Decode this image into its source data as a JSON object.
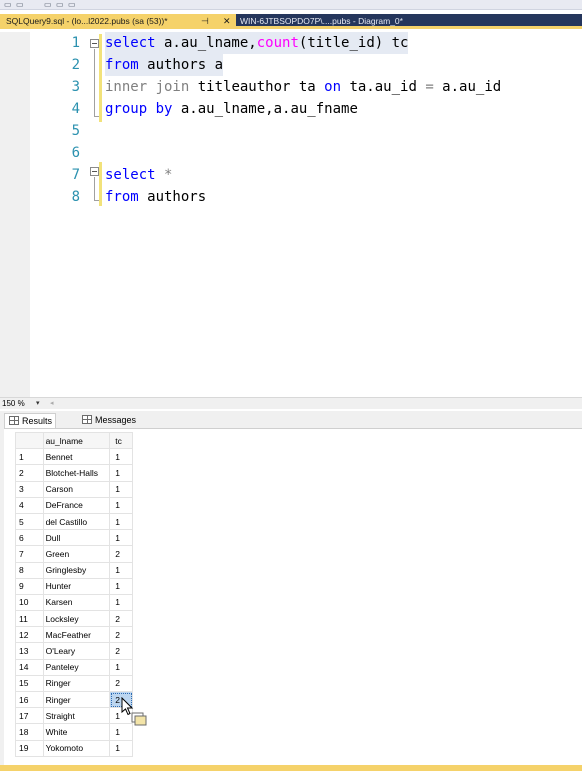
{
  "tabs": {
    "active": "SQLQuery9.sql - (lo...l2022.pubs (sa (53))*",
    "pin_glyph": "⊣",
    "close_glyph": "✕",
    "inactive": "WIN-6JTBSOPDO7P\\....pubs - Diagram_0*"
  },
  "editor": {
    "lines": [
      {
        "n": "1",
        "tokens": [
          {
            "t": "select",
            "c": "kw"
          },
          {
            "t": " a.au_lname,",
            "c": ""
          },
          {
            "t": "count",
            "c": "fn"
          },
          {
            "t": "(title_id) tc",
            "c": ""
          }
        ]
      },
      {
        "n": "2",
        "tokens": [
          {
            "t": "from",
            "c": "kw"
          },
          {
            "t": " authors a",
            "c": ""
          }
        ]
      },
      {
        "n": "3",
        "tokens": [
          {
            "t": "inner join",
            "c": "gr"
          },
          {
            "t": " titleauthor ta ",
            "c": ""
          },
          {
            "t": "on",
            "c": "kw"
          },
          {
            "t": " ta.au_id ",
            "c": ""
          },
          {
            "t": "=",
            "c": "gr"
          },
          {
            "t": " a.au_id",
            "c": ""
          }
        ]
      },
      {
        "n": "4",
        "tokens": [
          {
            "t": "group by",
            "c": "kw"
          },
          {
            "t": " a.au_lname,a.au_fname",
            "c": ""
          }
        ]
      },
      {
        "n": "5",
        "tokens": []
      },
      {
        "n": "6",
        "tokens": []
      },
      {
        "n": "7",
        "tokens": [
          {
            "t": "select",
            "c": "kw"
          },
          {
            "t": " *",
            "c": "gr"
          }
        ]
      },
      {
        "n": "8",
        "tokens": [
          {
            "t": "from",
            "c": "kw"
          },
          {
            "t": " authors",
            "c": ""
          }
        ]
      }
    ]
  },
  "zoom": {
    "value": "150 %"
  },
  "results_tabs": {
    "results": "Results",
    "messages": "Messages"
  },
  "grid": {
    "columns": [
      "au_lname",
      "tc"
    ],
    "rows": [
      [
        "1",
        "Bennet",
        "1"
      ],
      [
        "2",
        "Blotchet-Halls",
        "1"
      ],
      [
        "3",
        "Carson",
        "1"
      ],
      [
        "4",
        "DeFrance",
        "1"
      ],
      [
        "5",
        "del Castillo",
        "1"
      ],
      [
        "6",
        "Dull",
        "1"
      ],
      [
        "7",
        "Green",
        "2"
      ],
      [
        "8",
        "Gringlesby",
        "1"
      ],
      [
        "9",
        "Hunter",
        "1"
      ],
      [
        "10",
        "Karsen",
        "1"
      ],
      [
        "11",
        "Locksley",
        "2"
      ],
      [
        "12",
        "MacFeather",
        "2"
      ],
      [
        "13",
        "O'Leary",
        "2"
      ],
      [
        "14",
        "Panteley",
        "1"
      ],
      [
        "15",
        "Ringer",
        "2"
      ],
      [
        "16",
        "Ringer",
        "2"
      ],
      [
        "17",
        "Straight",
        "1"
      ],
      [
        "18",
        "White",
        "1"
      ],
      [
        "19",
        "Yokomoto",
        "1"
      ]
    ],
    "selected_row": 16
  },
  "colors": {
    "keyword": "#0000ff",
    "function": "#ff00ff",
    "operator_gray": "#808080",
    "line_number": "#2b91af",
    "tab_bar": "#25365c",
    "active_tab": "#f5d26a"
  }
}
